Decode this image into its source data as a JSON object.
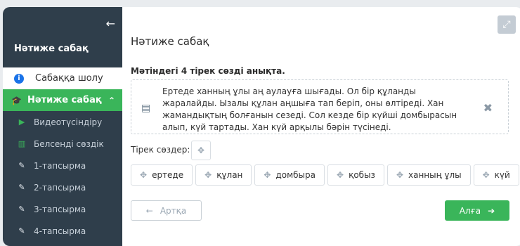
{
  "sidebar": {
    "back_icon": "←",
    "title": "Нәтиже сабақ",
    "overview_label": "Сабаққа шолу",
    "active_label": "Нәтиже сабақ",
    "items": [
      {
        "label": "Видеотүсіндіру",
        "icon": "play-icon"
      },
      {
        "label": "Белсенді сөздік",
        "icon": "book-icon"
      },
      {
        "label": "1-тапсырма",
        "icon": "edit-icon"
      },
      {
        "label": "2-тапсырма",
        "icon": "edit-icon"
      },
      {
        "label": "3-тапсырма",
        "icon": "edit-icon"
      },
      {
        "label": "4-тапсырма",
        "icon": "edit-icon"
      }
    ]
  },
  "main": {
    "page_title": "Нәтиже сабақ",
    "task_title": "Мәтіндегі 4 тірек сөзді анықта.",
    "passage": "Ертеде ханның ұлы аң аулауға шығады. Ол бір құланды жаралайды. Ызалы құлан аңшыға тап беріп, оны өлтіреді. Хан жамандықтың болғанын сезеді. Сол кезде бір күйші домбырасын алып, күй тартады. Хан күй арқылы бәрін түсінеді.",
    "keywords_label": "Тірек сөздер:",
    "keyword_chips": [
      "ертеде",
      "құлан",
      "домбыра",
      "қобыз",
      "ханның ұлы",
      "күй"
    ],
    "back_button": "Артқа",
    "next_button": "Алға"
  },
  "colors": {
    "sidebar_bg": "#2f3e4b",
    "accent_green": "#3ab55a",
    "info_blue": "#1a73e8"
  }
}
